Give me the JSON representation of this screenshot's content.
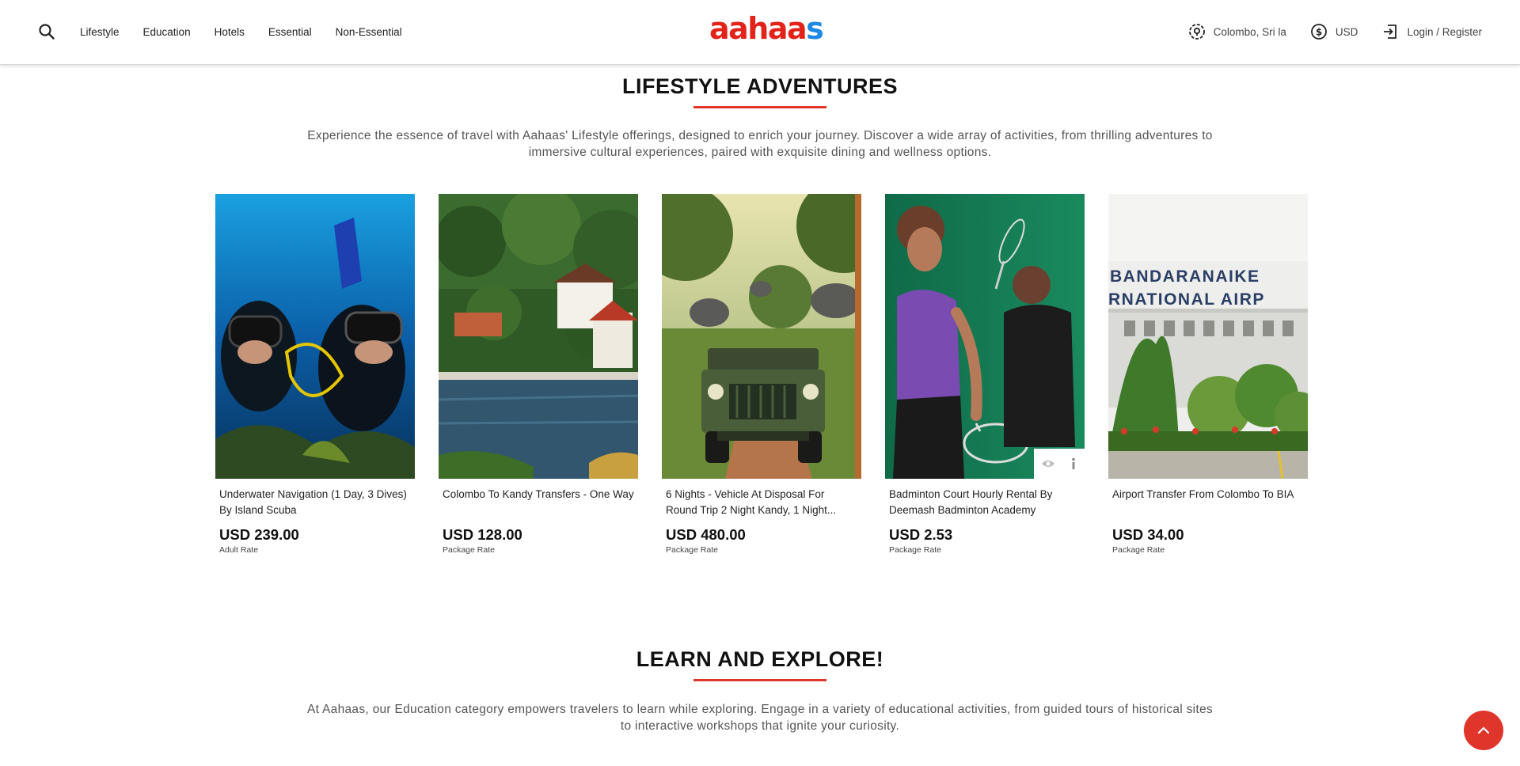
{
  "header": {
    "logo": {
      "part1": "aahaa",
      "part2": "s"
    },
    "nav": [
      "Lifestyle",
      "Education",
      "Hotels",
      "Essential",
      "Non-Essential"
    ],
    "location": "Colombo, Sri la",
    "currency": "USD",
    "login": "Login / Register",
    "icons": {
      "search": "search-icon",
      "location": "location-pin-icon",
      "currency": "currency-icon",
      "login": "login-icon"
    }
  },
  "lifestyle": {
    "title": "LIFESTYLE ADVENTURES",
    "description": "Experience the essence of travel with Aahaas' Lifestyle offerings, designed to enrich your journey. Discover a wide array of activities, from thrilling adventures to immersive cultural experiences, paired with exquisite dining and wellness options.",
    "products": [
      {
        "title": "Underwater Navigation (1 Day, 3 Dives) By Island Scuba",
        "price": "USD 239.00",
        "rate": "Adult Rate"
      },
      {
        "title": "Colombo To Kandy Transfers - One Way",
        "price": "USD 128.00",
        "rate": "Package Rate"
      },
      {
        "title": "6 Nights - Vehicle At Disposal For Round Trip 2 Night Kandy, 1 Night...",
        "price": "USD 480.00",
        "rate": "Package Rate"
      },
      {
        "title": "Badminton Court Hourly Rental By Deemash Badminton Academy",
        "price": "USD 2.53",
        "rate": "Package Rate"
      },
      {
        "title": "Airport Transfer From Colombo To BIA",
        "price": "USD 34.00",
        "rate": "Package Rate"
      }
    ],
    "airport_sign": {
      "line1": "BANDARANAIKE",
      "line2": "RNATIONAL AIRP"
    }
  },
  "education": {
    "title": "LEARN AND EXPLORE!",
    "description": "At Aahaas, our Education category empowers travelers to learn while exploring. Engage in a variety of educational activities, from guided tours of historical sites to interactive workshops that ignite your curiosity."
  },
  "colors": {
    "accent": "#e0352b",
    "logo_red": "#e2231a",
    "logo_blue": "#1e88e5"
  }
}
